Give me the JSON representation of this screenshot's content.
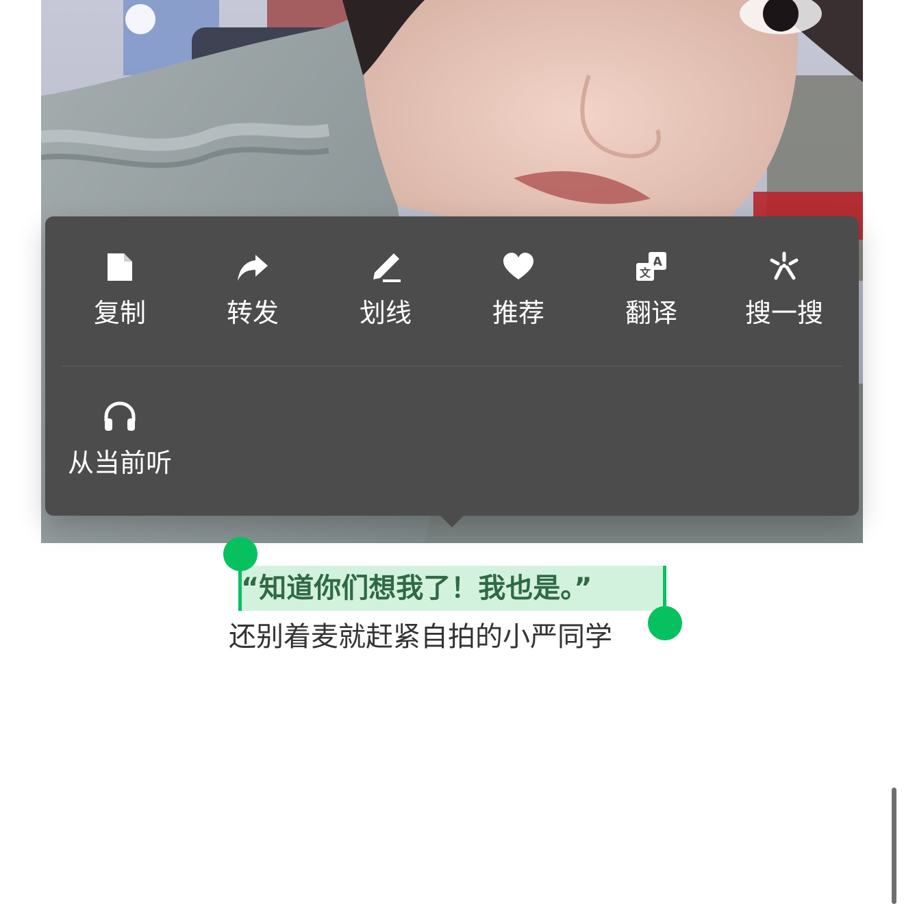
{
  "menu": {
    "row1": [
      {
        "label": "复制",
        "icon": "document-icon"
      },
      {
        "label": "转发",
        "icon": "share-arrow-icon"
      },
      {
        "label": "划线",
        "icon": "pen-underline-icon"
      },
      {
        "label": "推荐",
        "icon": "heart-icon"
      },
      {
        "label": "翻译",
        "icon": "translate-icon"
      },
      {
        "label": "搜一搜",
        "icon": "search-sparkle-icon"
      }
    ],
    "row2": [
      {
        "label": "从当前听",
        "icon": "headphones-icon"
      }
    ]
  },
  "caption": {
    "selected_line": "“知道你们想我了！我也是。”",
    "second_line": "还别着麦就赶紧自拍的小严同学"
  },
  "colors": {
    "menu_bg": "#4c4c4c",
    "selection_handle": "#07c160",
    "selection_bg": "#d3f2de",
    "selected_text": "#2f6a45",
    "body_text": "#333333"
  }
}
